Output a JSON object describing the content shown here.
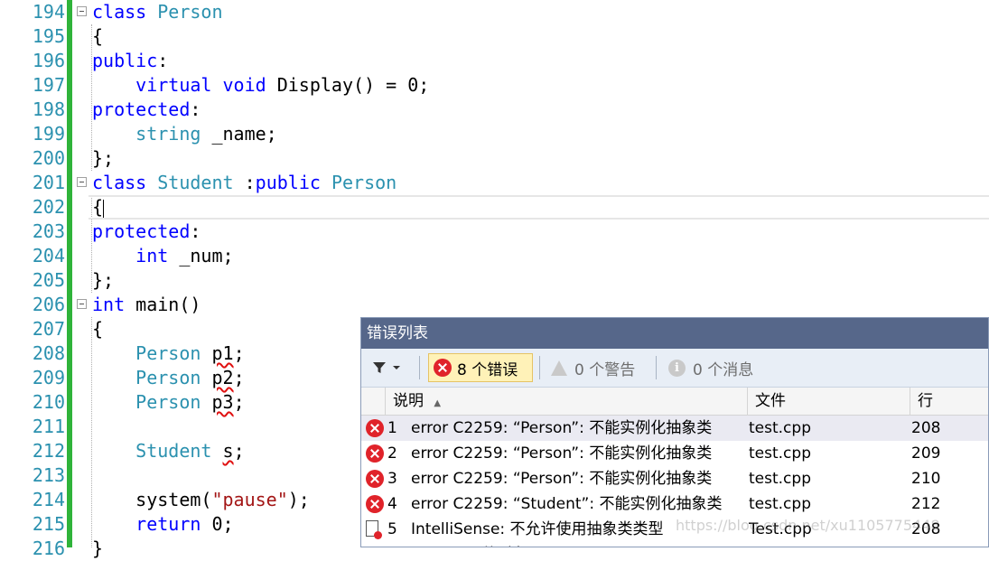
{
  "editor": {
    "lines": [
      {
        "n": "194",
        "fold": true,
        "tokens": [
          {
            "t": "class",
            "c": "kw"
          },
          {
            "t": " "
          },
          {
            "t": "Person",
            "c": "ty"
          }
        ]
      },
      {
        "n": "195",
        "fold": false,
        "tokens": [
          {
            "t": "{"
          }
        ]
      },
      {
        "n": "196",
        "fold": false,
        "tokens": [
          {
            "t": "public",
            "c": "kw"
          },
          {
            "t": ":"
          }
        ]
      },
      {
        "n": "197",
        "fold": false,
        "tokens": [
          {
            "t": "    "
          },
          {
            "t": "virtual",
            "c": "kw"
          },
          {
            "t": " "
          },
          {
            "t": "void",
            "c": "kw"
          },
          {
            "t": " Display() = 0;"
          }
        ]
      },
      {
        "n": "198",
        "fold": false,
        "tokens": [
          {
            "t": "protected",
            "c": "kw"
          },
          {
            "t": ":"
          }
        ]
      },
      {
        "n": "199",
        "fold": false,
        "tokens": [
          {
            "t": "    "
          },
          {
            "t": "string",
            "c": "ty"
          },
          {
            "t": " _name;"
          }
        ]
      },
      {
        "n": "200",
        "fold": false,
        "tokens": [
          {
            "t": "};"
          }
        ]
      },
      {
        "n": "201",
        "fold": true,
        "tokens": [
          {
            "t": "class",
            "c": "kw"
          },
          {
            "t": " "
          },
          {
            "t": "Student",
            "c": "ty"
          },
          {
            "t": " :"
          },
          {
            "t": "public",
            "c": "kw"
          },
          {
            "t": " "
          },
          {
            "t": "Person",
            "c": "ty"
          }
        ]
      },
      {
        "n": "202",
        "fold": false,
        "tokens": [
          {
            "t": "{"
          }
        ]
      },
      {
        "n": "203",
        "fold": false,
        "tokens": [
          {
            "t": "protected",
            "c": "kw"
          },
          {
            "t": ":"
          }
        ]
      },
      {
        "n": "204",
        "fold": false,
        "tokens": [
          {
            "t": "    "
          },
          {
            "t": "int",
            "c": "kw"
          },
          {
            "t": " _num;"
          }
        ]
      },
      {
        "n": "205",
        "fold": false,
        "tokens": [
          {
            "t": "};"
          }
        ]
      },
      {
        "n": "206",
        "fold": true,
        "tokens": [
          {
            "t": "int",
            "c": "kw"
          },
          {
            "t": " main()"
          }
        ]
      },
      {
        "n": "207",
        "fold": false,
        "tokens": [
          {
            "t": "{"
          }
        ]
      },
      {
        "n": "208",
        "fold": false,
        "tokens": [
          {
            "t": "    "
          },
          {
            "t": "Person",
            "c": "ty"
          },
          {
            "t": " "
          },
          {
            "t": "p1",
            "c": "wavy"
          },
          {
            "t": ";"
          }
        ]
      },
      {
        "n": "209",
        "fold": false,
        "tokens": [
          {
            "t": "    "
          },
          {
            "t": "Person",
            "c": "ty"
          },
          {
            "t": " "
          },
          {
            "t": "p2",
            "c": "wavy"
          },
          {
            "t": ";"
          }
        ]
      },
      {
        "n": "210",
        "fold": false,
        "tokens": [
          {
            "t": "    "
          },
          {
            "t": "Person",
            "c": "ty"
          },
          {
            "t": " "
          },
          {
            "t": "p3",
            "c": "wavy"
          },
          {
            "t": ";"
          }
        ]
      },
      {
        "n": "211",
        "fold": false,
        "tokens": []
      },
      {
        "n": "212",
        "fold": false,
        "tokens": [
          {
            "t": "    "
          },
          {
            "t": "Student",
            "c": "ty"
          },
          {
            "t": " "
          },
          {
            "t": "s",
            "c": "wavy"
          },
          {
            "t": ";"
          }
        ]
      },
      {
        "n": "213",
        "fold": false,
        "tokens": []
      },
      {
        "n": "214",
        "fold": false,
        "tokens": [
          {
            "t": "    system("
          },
          {
            "t": "\"pause\"",
            "c": "str"
          },
          {
            "t": ");"
          }
        ]
      },
      {
        "n": "215",
        "fold": false,
        "tokens": [
          {
            "t": "    "
          },
          {
            "t": "return",
            "c": "kw"
          },
          {
            "t": " 0;"
          }
        ]
      },
      {
        "n": "216",
        "fold": false,
        "tokens": [
          {
            "t": "}"
          }
        ]
      }
    ]
  },
  "error_list": {
    "title": "错误列表",
    "errors_label": "8 个错误",
    "warnings_label": "0 个警告",
    "messages_label": "0 个消息",
    "columns": {
      "description": "说明",
      "sort_arrow": "▲",
      "file": "文件",
      "line": "行"
    },
    "rows": [
      {
        "num": "1",
        "icon": "error",
        "desc": "error C2259: “Person”: 不能实例化抽象类",
        "file": "test.cpp",
        "line": "208"
      },
      {
        "num": "2",
        "icon": "error",
        "desc": "error C2259: “Person”: 不能实例化抽象类",
        "file": "test.cpp",
        "line": "209"
      },
      {
        "num": "3",
        "icon": "error",
        "desc": "error C2259: “Person”: 不能实例化抽象类",
        "file": "test.cpp",
        "line": "210"
      },
      {
        "num": "4",
        "icon": "error",
        "desc": "error C2259: “Student”: 不能实例化抽象类",
        "file": "test.cpp",
        "line": "212"
      },
      {
        "num": "5",
        "icon": "intellisense",
        "desc": "IntelliSense:  不允许使用抽象类类型",
        "file": "Test.cpp",
        "line": "208"
      },
      {
        "num": "",
        "icon": "none",
        "desc": "“Person” 的对象:",
        "file": "",
        "line": ""
      }
    ]
  },
  "watermark": "https://blog.csdn.net/xu1105775448",
  "colors": {
    "keyword": "#0000ff",
    "type": "#2b91af",
    "string": "#a31515",
    "line_number": "#2b91af",
    "change_bar": "#2fb33a",
    "panel_title": "#56678a"
  }
}
